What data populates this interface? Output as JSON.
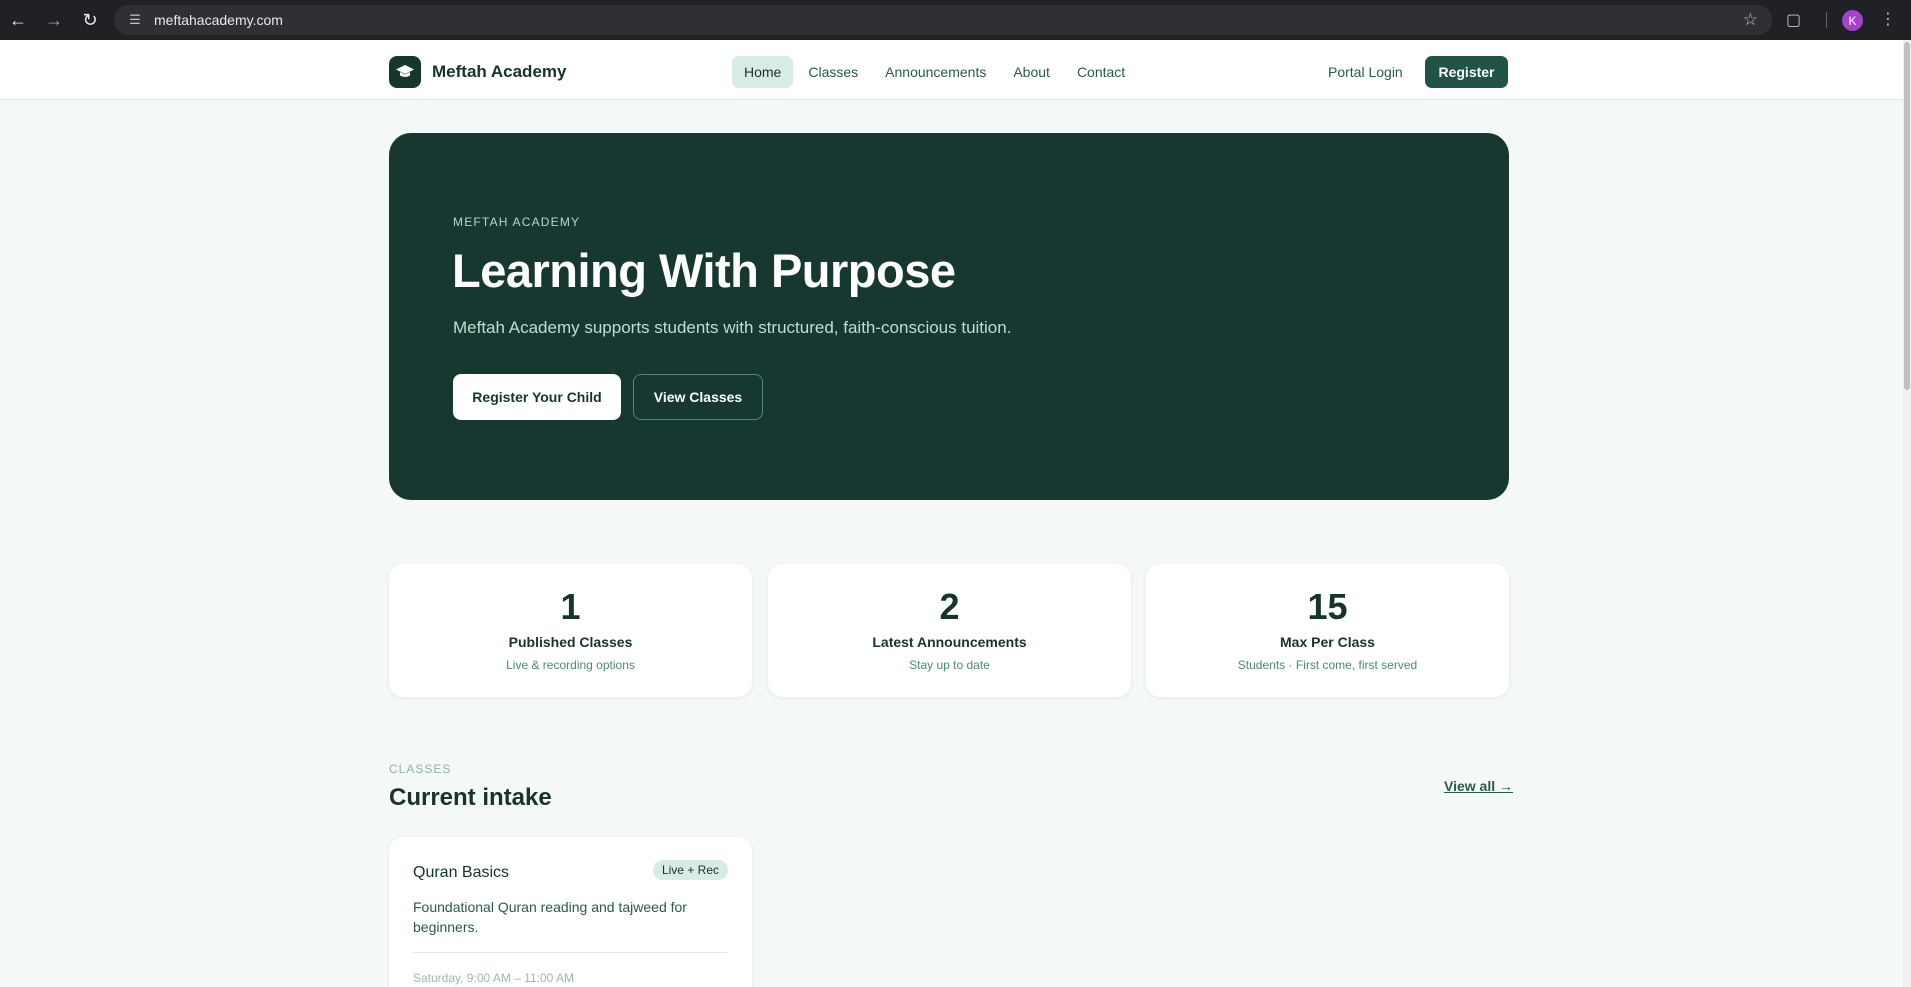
{
  "browser": {
    "url": "meftahacademy.com",
    "profile_initial": "K"
  },
  "header": {
    "brand": "Meftah Academy",
    "nav": [
      {
        "label": "Home",
        "active": true
      },
      {
        "label": "Classes",
        "active": false
      },
      {
        "label": "Announcements",
        "active": false
      },
      {
        "label": "About",
        "active": false
      },
      {
        "label": "Contact",
        "active": false
      }
    ],
    "portal_login": "Portal Login",
    "register": "Register"
  },
  "hero": {
    "eyebrow": "MEFTAH ACADEMY",
    "title": "Learning With Purpose",
    "subtitle": "Meftah Academy supports students with structured, faith-conscious tuition.",
    "primary_button": "Register Your Child",
    "secondary_button": "View Classes"
  },
  "stats": [
    {
      "value": "1",
      "label": "Published Classes",
      "desc": "Live & recording options"
    },
    {
      "value": "2",
      "label": "Latest Announcements",
      "desc": "Stay up to date"
    },
    {
      "value": "15",
      "label": "Max Per Class",
      "desc": "Students · First come, first served"
    }
  ],
  "classes_section": {
    "eyebrow": "CLASSES",
    "title": "Current intake",
    "view_all": "View all →",
    "cards": [
      {
        "title": "Quran Basics",
        "badge": "Live + Rec",
        "description": "Foundational Quran reading and tajweed for beginners.",
        "schedule": "Saturday, 9:00 AM – 11:00 AM"
      }
    ]
  },
  "colors": {
    "brand_dark": "#173830",
    "accent": "#1f5446",
    "page_bg": "#f4f8f7",
    "active_nav_bg": "#d8ece6"
  }
}
